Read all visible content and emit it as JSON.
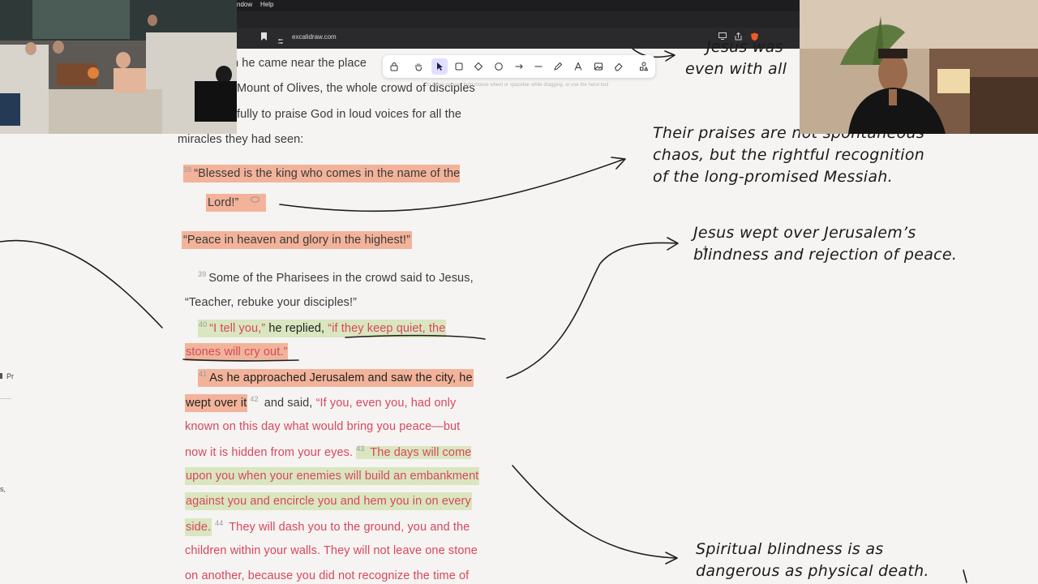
{
  "menubar": {
    "items": [
      "ndow",
      "Help"
    ]
  },
  "browser": {
    "url": "excalidraw.com"
  },
  "toolbar": {
    "tools": [
      {
        "name": "lock",
        "key": ""
      },
      {
        "name": "hand",
        "key": ""
      },
      {
        "name": "selection",
        "key": "1"
      },
      {
        "name": "rectangle",
        "key": "2"
      },
      {
        "name": "diamond",
        "key": "3"
      },
      {
        "name": "ellipse",
        "key": "4"
      },
      {
        "name": "arrow",
        "key": "5"
      },
      {
        "name": "line",
        "key": "6"
      },
      {
        "name": "draw",
        "key": "7"
      },
      {
        "name": "text",
        "key": "8"
      },
      {
        "name": "image",
        "key": "9"
      },
      {
        "name": "eraser",
        "key": "0"
      },
      {
        "name": "more",
        "key": ""
      }
    ],
    "active": "selection",
    "hint": "To move canvas, hold mouse wheel or spacebar while dragging, or use the hand tool"
  },
  "passage": {
    "l1": "n he came near the place",
    "l2": "Mount of Olives, the whole crowd of disciples",
    "l3": "fully to praise God in loud voices for all the",
    "l4": "miracles they had seen:",
    "v38": "38",
    "l5": "“Blessed is the king who comes in the name of the",
    "l6": "Lord!”",
    "l7": "“Peace in heaven and glory in the highest!”",
    "v39": "39",
    "l8": "Some of the Pharisees in the crowd said to Jesus,",
    "l9": "“Teacher, rebuke your disciples!”",
    "v40": "40",
    "l10a": "“I tell you,”",
    "l10b": " he replied, ",
    "l10c": "“if they keep quiet, the",
    "l11": "stones will cry out.”",
    "v41": "41",
    "l12": "As he approached Jerusalem and saw the city, he",
    "l13a": "wept over it",
    "v42": "42",
    "l13b": " and said, ",
    "l13c": "“If you, even you, had only",
    "l14": "known on this day what would bring you peace—but",
    "l15a": "now it is hidden from your eyes. ",
    "v43": "43",
    "l15b": " The days will come",
    "l16": "upon you when your enemies will build an embankment",
    "l17": "against you and encircle you and hem you in on every",
    "l18a": "side.",
    "v44": "44",
    "l18b": " They will dash you to the ground, you and the",
    "l19": "children within your walls. They will not leave one stone",
    "l20": "on another, because you did not recognize the time of"
  },
  "notes": {
    "top1": "Jesus was",
    "top2": "even with all",
    "n1a": "Their praises are not spontaneous",
    "n1b": "chaos, but the rightful recognition",
    "n1c": "of the long-promised Messiah.",
    "n2a": "Jesus wept over Jerusalem’s",
    "n2b": "blindness and rejection of peace.",
    "n3a": "Spiritual blindness is as",
    "n3b": "dangerous as physical death."
  },
  "side": {
    "a": "Pr",
    "b": "s,"
  },
  "colors": {
    "accent": "#6965db",
    "highlight_orange": "#f3b39a",
    "highlight_green": "#d9e6bf",
    "red_text": "#d9465e"
  }
}
